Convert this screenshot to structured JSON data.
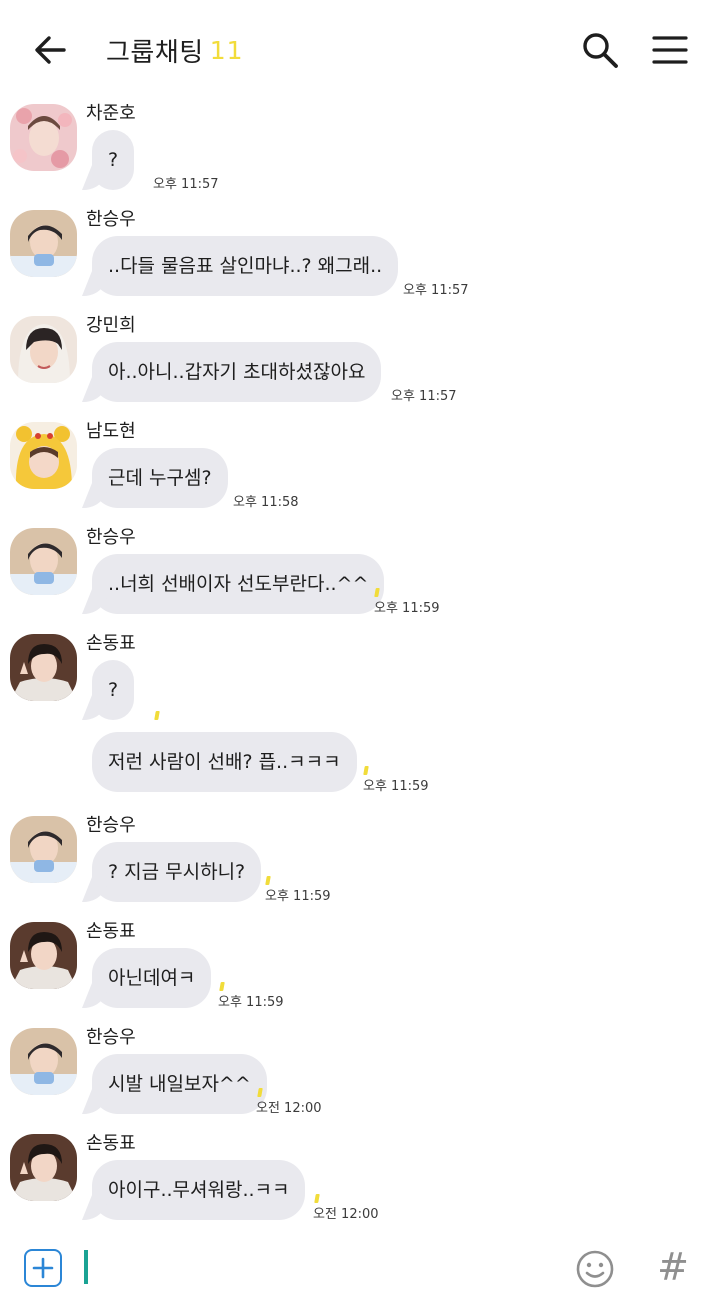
{
  "header": {
    "title": "그룹채팅",
    "member_count": "11",
    "back_icon": "arrow-left-icon",
    "search_icon": "search-icon",
    "menu_icon": "hamburger-menu-icon"
  },
  "colors": {
    "bubble": "#e9e9ee",
    "count": "#f2dc3a",
    "unread_mark": "#f1dc3a",
    "plus": "#2b86d6",
    "cursor": "#1aa394"
  },
  "messages": [
    {
      "sender": "차준호",
      "avatar": "avatar-chajunho",
      "bubbles": [
        "?"
      ],
      "time": "오후 11:57"
    },
    {
      "sender": "한승우",
      "avatar": "avatar-hanseungwoo",
      "bubbles": [
        "..다들 물음표 살인마냐..? 왜그래.."
      ],
      "time": "오후 11:57"
    },
    {
      "sender": "강민희",
      "avatar": "avatar-kangminhee",
      "bubbles": [
        "아..아니..갑자기 초대하셨잖아요"
      ],
      "time": "오후 11:57"
    },
    {
      "sender": "남도현",
      "avatar": "avatar-namdohyun",
      "bubbles": [
        "근데 누구셈?"
      ],
      "time": "오후 11:58"
    },
    {
      "sender": "한승우",
      "avatar": "avatar-hanseungwoo",
      "bubbles": [
        "..너희 선배이자 선도부란다..^^"
      ],
      "time": "오후 11:59"
    },
    {
      "sender": "손동표",
      "avatar": "avatar-sondongpyo",
      "bubbles": [
        "?",
        "저런 사람이 선배? 픕..ㅋㅋㅋ"
      ],
      "time": "오후 11:59"
    },
    {
      "sender": "한승우",
      "avatar": "avatar-hanseungwoo",
      "bubbles": [
        "? 지금 무시하니?"
      ],
      "time": "오후 11:59"
    },
    {
      "sender": "손동표",
      "avatar": "avatar-sondongpyo",
      "bubbles": [
        "아닌데여ㅋ"
      ],
      "time": "오후 11:59"
    },
    {
      "sender": "한승우",
      "avatar": "avatar-hanseungwoo",
      "bubbles": [
        "시발 내일보자^^"
      ],
      "time": "오전 12:00"
    },
    {
      "sender": "손동표",
      "avatar": "avatar-sondongpyo",
      "bubbles": [
        "아이구..무셔워랑..ㅋㅋ"
      ],
      "time": "오전 12:00"
    }
  ],
  "input": {
    "value": "",
    "placeholder": ""
  },
  "bottom_icons": {
    "plus": "plus-box-icon",
    "emoji": "smiley-icon",
    "hash": "#"
  }
}
